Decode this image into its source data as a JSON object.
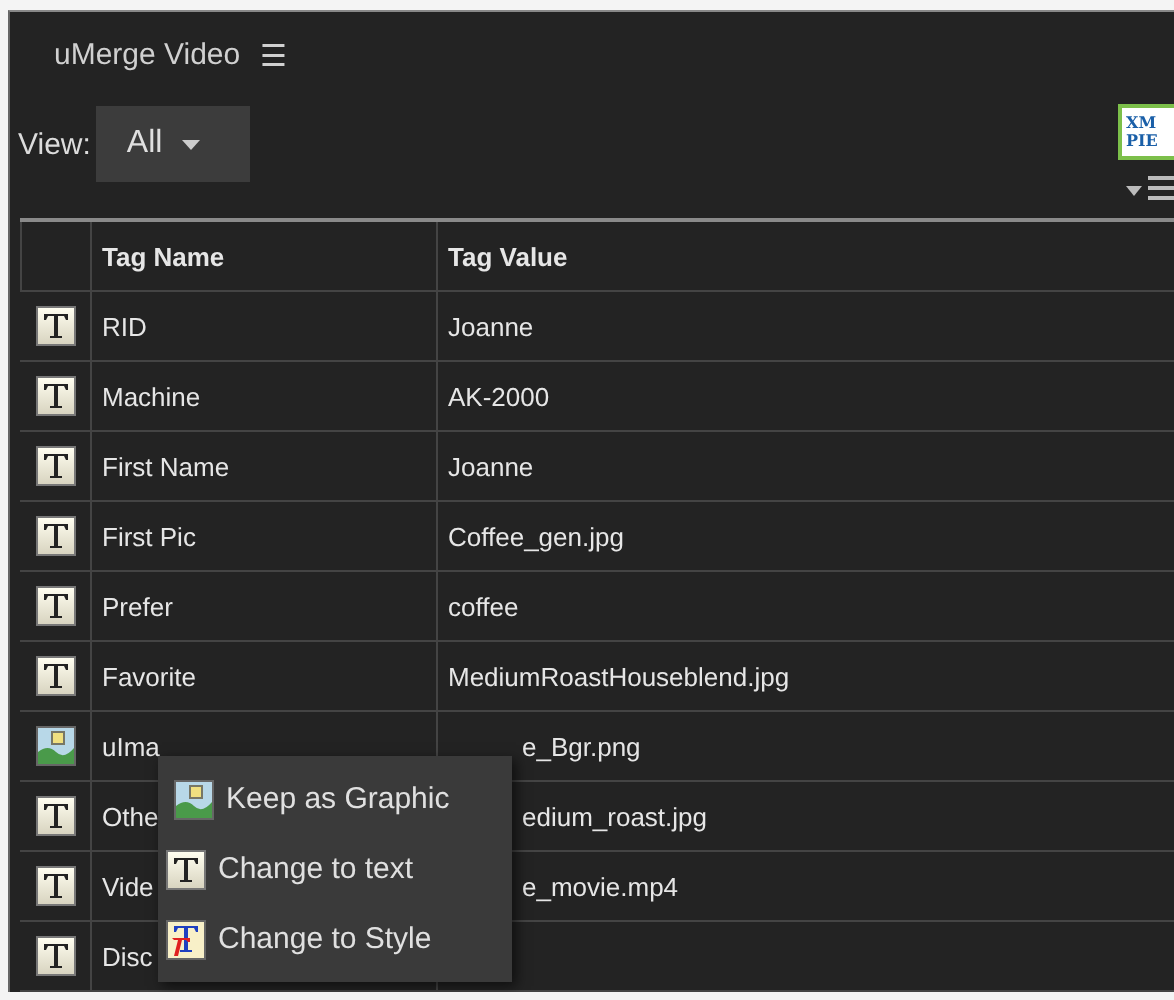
{
  "panel": {
    "title": "uMerge Video",
    "menu_glyph": "☰"
  },
  "view": {
    "label": "View:",
    "value": "All"
  },
  "logo": {
    "text_1": "XM",
    "text_2": "PIE"
  },
  "table": {
    "columns": [
      "Tag Name",
      "Tag Value"
    ],
    "rows": [
      {
        "kind": "text",
        "name": "RID",
        "value": "Joanne",
        "covered": false
      },
      {
        "kind": "text",
        "name": "Machine",
        "value": "AK-2000",
        "covered": false
      },
      {
        "kind": "text",
        "name": "First Name",
        "value": "Joanne",
        "covered": false
      },
      {
        "kind": "text",
        "name": "First Pic",
        "value": "Coffee_gen.jpg",
        "covered": false
      },
      {
        "kind": "text",
        "name": "Prefer",
        "value": "coffee",
        "covered": false
      },
      {
        "kind": "text",
        "name": "Favorite",
        "value": "MediumRoastHouseblend.jpg",
        "covered": false
      },
      {
        "kind": "graphic",
        "name": "uIma",
        "value": "e_Bgr.png",
        "covered": true
      },
      {
        "kind": "text",
        "name": "Othe",
        "value": "edium_roast.jpg",
        "covered": true
      },
      {
        "kind": "text",
        "name": "Vide",
        "value": "e_movie.mp4",
        "covered": true
      },
      {
        "kind": "text",
        "name": "Disc"
      }
    ]
  },
  "context_menu": [
    {
      "kind": "graphic",
      "label": "Keep as Graphic"
    },
    {
      "kind": "text",
      "label": "Change to text"
    },
    {
      "kind": "style",
      "label": "Change to Style"
    }
  ]
}
